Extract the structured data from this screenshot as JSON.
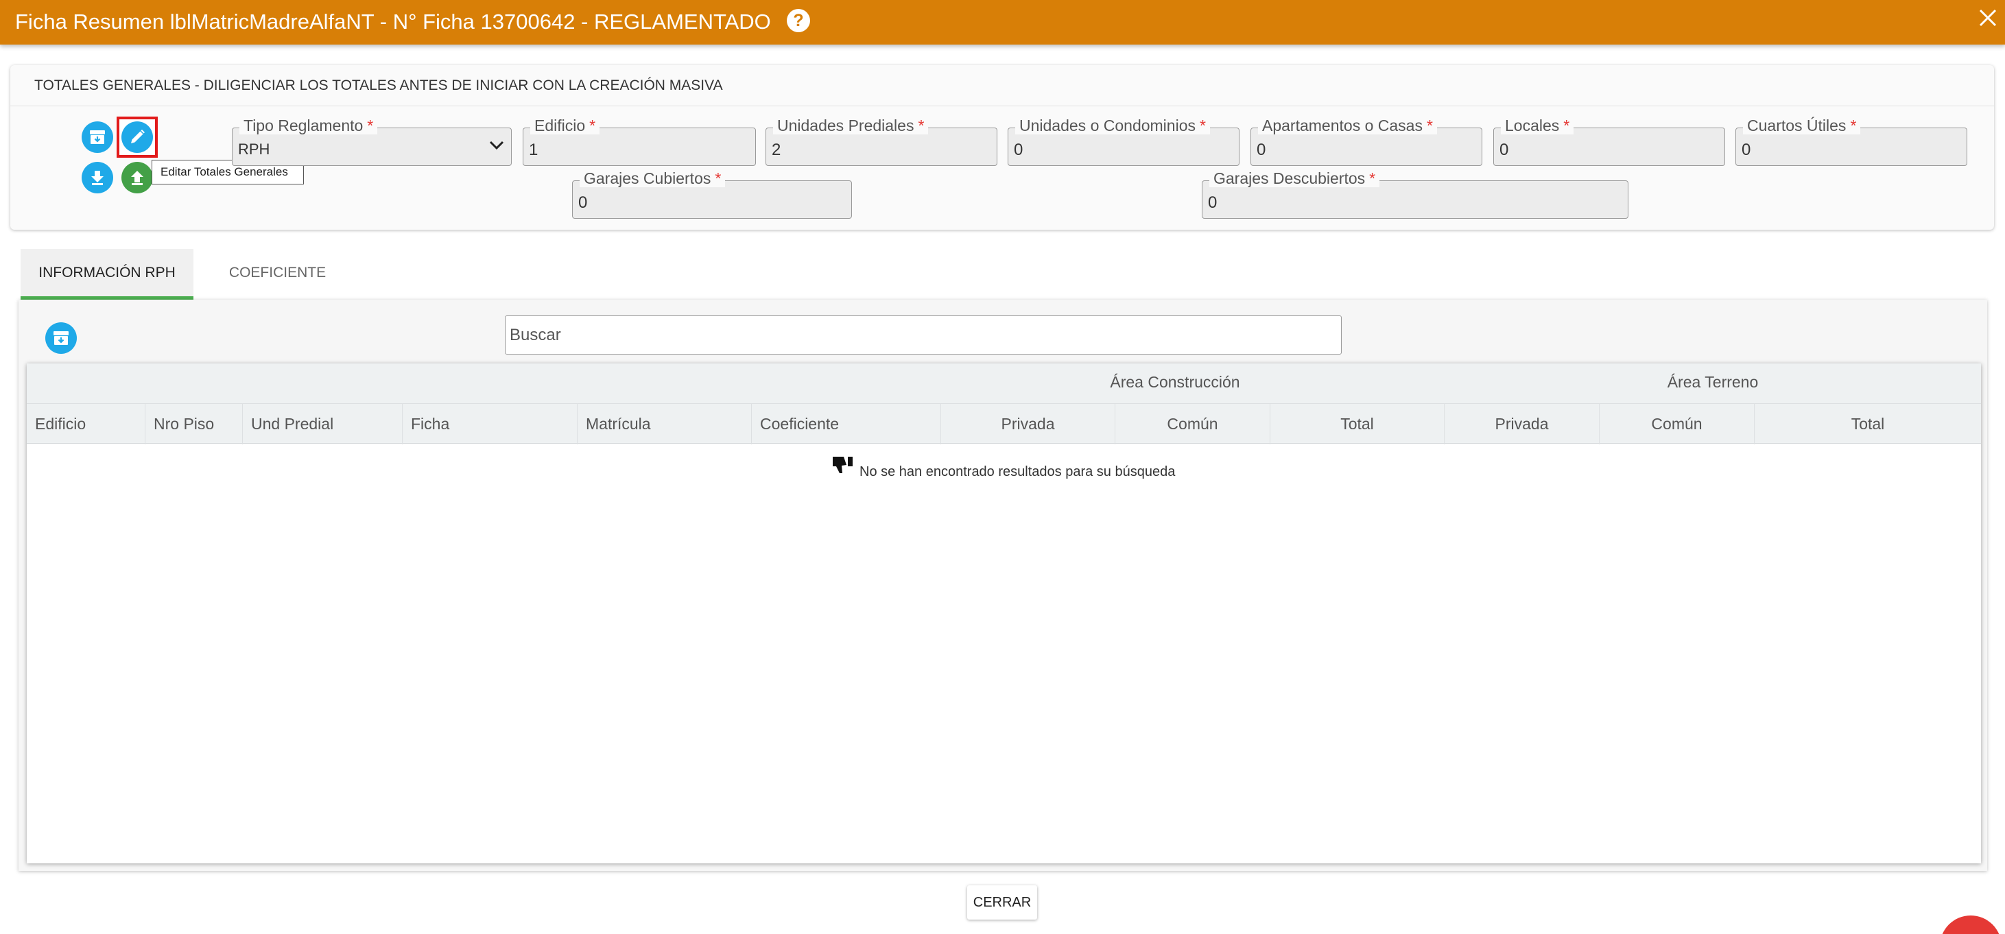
{
  "window": {
    "title": "Ficha Resumen lblMatricMadreAlfaNT - N° Ficha 13700642 - REGLAMENTADO",
    "help_glyph": "?"
  },
  "totales": {
    "header": "TOTALES GENERALES - DILIGENCIAR LOS TOTALES ANTES DE INICIAR CON LA CREACIÓN MASIVA",
    "tooltip": "Editar Totales Generales",
    "required_mark": "*",
    "fields": {
      "tipo_reglamento": {
        "label": "Tipo Reglamento",
        "value": "RPH"
      },
      "edificio": {
        "label": "Edificio",
        "value": "1"
      },
      "unidades_prediales": {
        "label": "Unidades Prediales",
        "value": "2"
      },
      "unidades_condominios": {
        "label": "Unidades o Condominios",
        "value": "0"
      },
      "apartamentos_casas": {
        "label": "Apartamentos o Casas",
        "value": "0"
      },
      "locales": {
        "label": "Locales",
        "value": "0"
      },
      "cuartos_utiles": {
        "label": "Cuartos Útiles",
        "value": "0"
      },
      "garajes_cubiertos": {
        "label": "Garajes Cubiertos",
        "value": "0"
      },
      "garajes_descubiertos": {
        "label": "Garajes Descubiertos",
        "value": "0"
      }
    }
  },
  "tabs": [
    {
      "label": "INFORMACIÓN RPH",
      "active": true
    },
    {
      "label": "COEFICIENTE",
      "active": false
    }
  ],
  "search": {
    "placeholder": "Buscar"
  },
  "table": {
    "group_headers": [
      "Área Construcción",
      "Área Terreno"
    ],
    "columns": [
      "Edificio",
      "Nro Piso",
      "Und Predial",
      "Ficha",
      "Matrícula",
      "Coeficiente",
      "Privada",
      "Común",
      "Total",
      "Privada",
      "Común",
      "Total"
    ],
    "empty_message": "No se han encontrado resultados para su búsqueda"
  },
  "footer": {
    "close_label": "CERRAR"
  },
  "colors": {
    "titlebar": "#d87f07",
    "primary_blue": "#1fa9e8",
    "success_green": "#43a047",
    "tab_indicator": "#4caf50",
    "required": "#e53935",
    "highlight_box": "#e21b1b"
  }
}
